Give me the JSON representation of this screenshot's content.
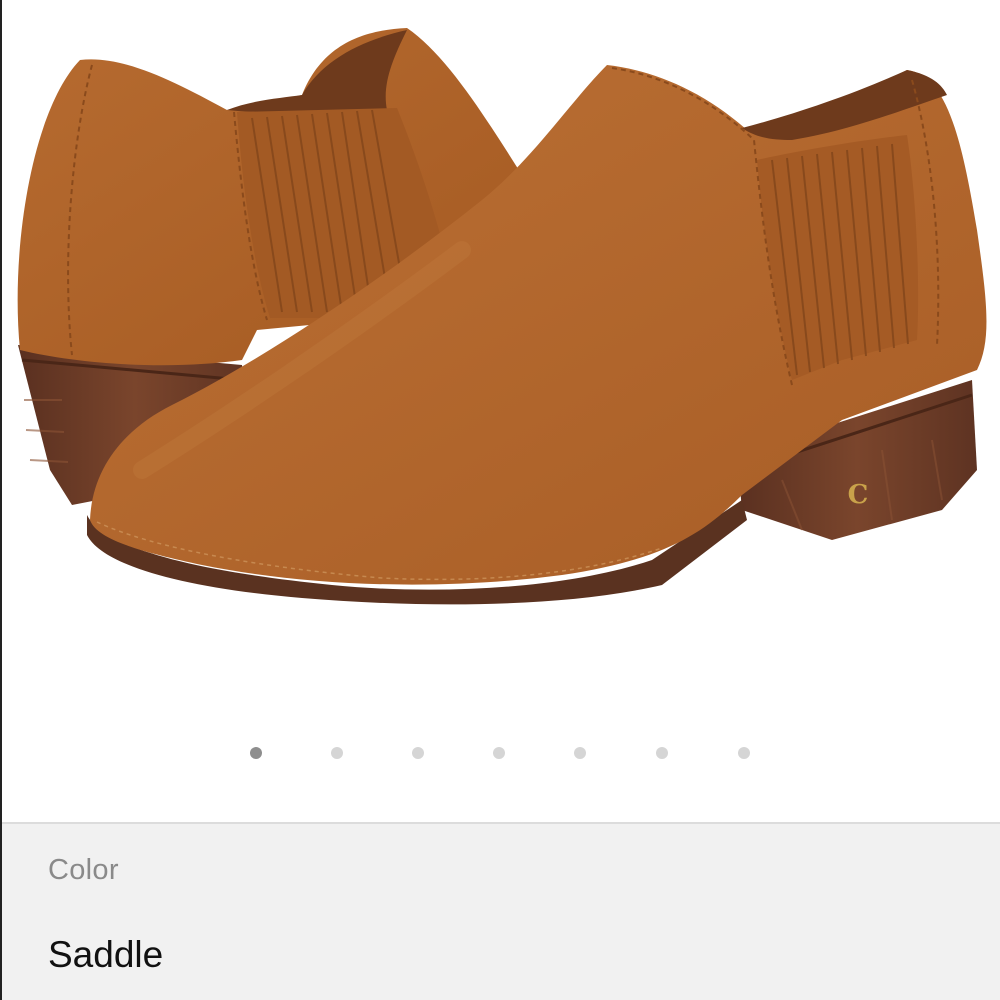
{
  "gallery": {
    "image": {
      "subject": "product-photo",
      "colors": {
        "suede": "#b0642a",
        "suede_shadow": "#8a4a1c",
        "sole": "#5a3220",
        "heel": "#6b3a24",
        "emblem": "#c9a24a"
      }
    },
    "pagination": {
      "total": 7,
      "current": 1
    }
  },
  "options": {
    "color_label": "Color",
    "color_value": "Saddle"
  },
  "theme": {
    "panel_bg": "#f1f1f1",
    "dot_active": "#8e8e8e",
    "dot_inactive": "#d5d5d5"
  }
}
